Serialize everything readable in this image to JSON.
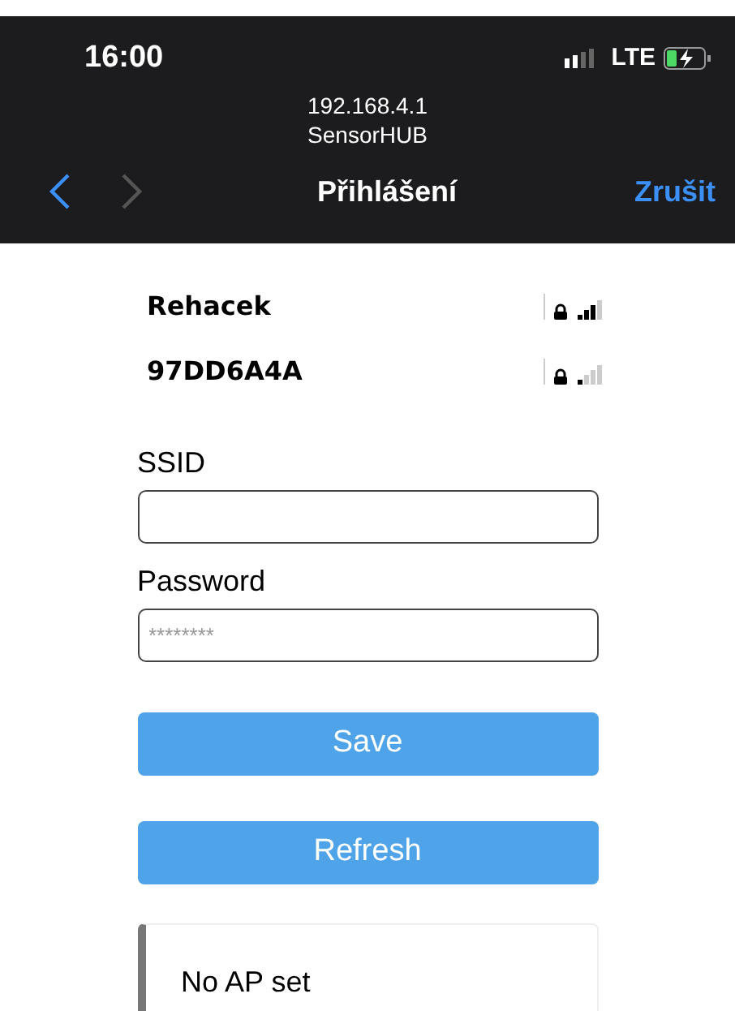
{
  "status_bar": {
    "time": "16:00",
    "network": "LTE"
  },
  "address_bar": {
    "url": "192.168.4.1",
    "site": "SensorHUB"
  },
  "nav_bar": {
    "back_enabled": true,
    "forward_enabled": false,
    "title": "Přihlášení",
    "cancel": "Zrušit"
  },
  "networks": [
    {
      "name": "Rehacek",
      "secure": true,
      "level": 0.75
    },
    {
      "name": "97DD6A4A",
      "secure": true,
      "level": 0.25
    }
  ],
  "form": {
    "ssid_label": "SSID",
    "password_label": "Password",
    "password_placeholder": "********"
  },
  "buttons": [
    "Save",
    "Refresh"
  ],
  "message": "No AP set"
}
